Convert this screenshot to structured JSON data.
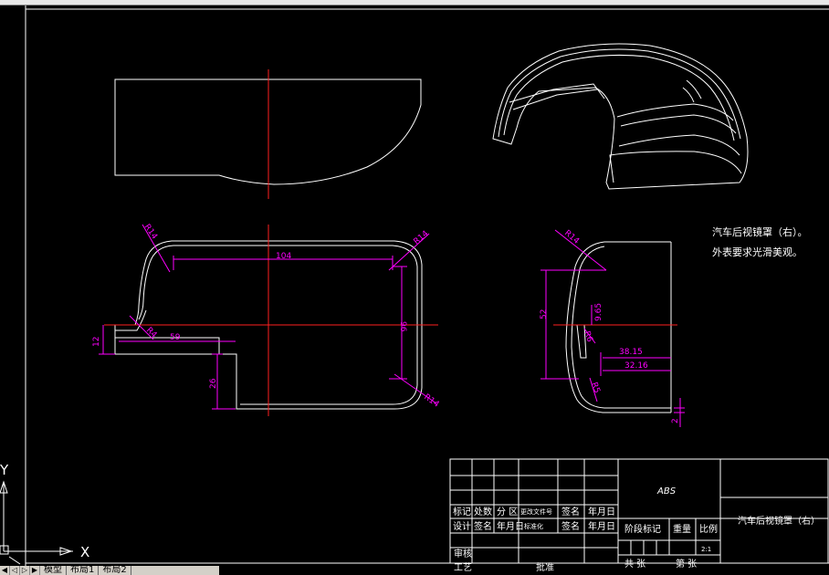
{
  "drawing": {
    "dimensions": {
      "front_width": "104",
      "front_height": "96",
      "front_left_len": "59",
      "front_step": "26",
      "front_notch": "12",
      "radius_top_left": "R14",
      "radius_top_right": "R14",
      "radius_bottom_right": "R14",
      "radius_inner": "R4",
      "side_radius_top": "R14",
      "side_height": "52",
      "side_965": "9.65",
      "side_3815": "38.15",
      "side_3216": "32.16",
      "side_r6": "R6",
      "side_r5": "R5",
      "side_2": "2"
    },
    "notes": {
      "line1": "汽车后视镜罩（右）。",
      "line2": "外表要求光滑美观。"
    }
  },
  "title_block": {
    "material": "ABS",
    "part_name": "汽车后视镜罩（右）",
    "row_mark": [
      "标记",
      "处数",
      "分 区",
      "更改文件号",
      "签名",
      "年月日"
    ],
    "row_design": [
      "设计",
      "签名",
      "年月日",
      "标准化",
      "签名",
      "年月日"
    ],
    "stage_mark": "阶段标记",
    "weight": "重量",
    "scale": "比例",
    "scale_value": "2:1",
    "review": "审核",
    "process": "工艺",
    "approve": "批准",
    "sheets_total": "共 张",
    "sheet_no": "第 张"
  },
  "ucs": {
    "x_label": "X",
    "y_label": "Y"
  },
  "tabs": {
    "model": "模型",
    "layout1": "布局1",
    "layout2": "布局2"
  }
}
